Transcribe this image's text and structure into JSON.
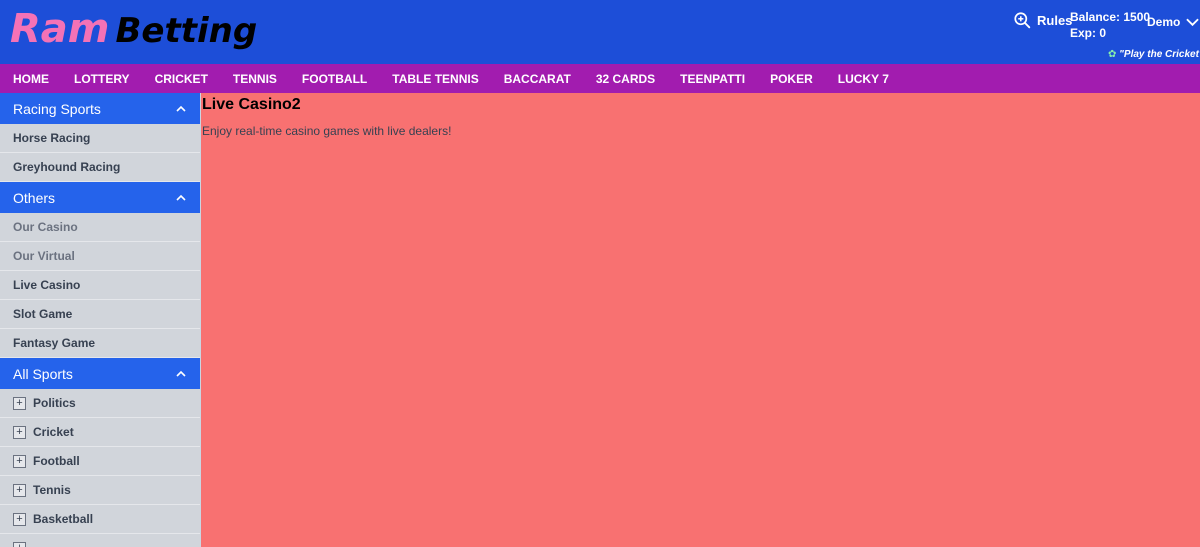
{
  "header": {
    "logo_ram": "Ram",
    "logo_betting": "Betting",
    "rules_label": "Rules",
    "balance_label": "Balance: 1500",
    "exp_label": "Exp: 0",
    "user_label": "Demo",
    "marquee": "\"Play the Cricket"
  },
  "nav": [
    "HOME",
    "LOTTERY",
    "CRICKET",
    "TENNIS",
    "FOOTBALL",
    "TABLE TENNIS",
    "BACCARAT",
    "32 CARDS",
    "TEENPATTI",
    "POKER",
    "LUCKY 7"
  ],
  "sidebar": {
    "racing": {
      "title": "Racing Sports",
      "items": [
        "Horse Racing",
        "Greyhound Racing"
      ]
    },
    "others": {
      "title": "Others",
      "items": [
        "Our Casino",
        "Our Virtual",
        "Live Casino",
        "Slot Game",
        "Fantasy Game"
      ]
    },
    "all_sports": {
      "title": "All Sports",
      "items": [
        "Politics",
        "Cricket",
        "Football",
        "Tennis",
        "Basketball"
      ]
    }
  },
  "content": {
    "title": "Live Casino2",
    "subtitle": "Enjoy real-time casino games with live dealers!"
  },
  "colors": {
    "header_bg": "#1d4ed8",
    "nav_bg": "#a21caf",
    "section_head": "#2563eb",
    "content_bg": "#f87171",
    "logo_accent": "#f472b6"
  }
}
